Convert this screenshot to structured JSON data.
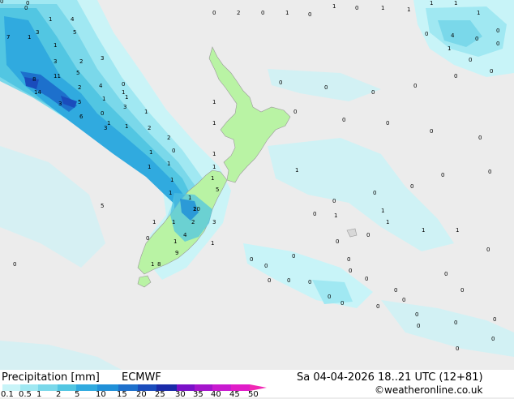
{
  "header": {
    "product": "Precipitation [mm]",
    "model": "ECMWF",
    "valid_time": "Sa 04-04-2026 18..21 UTC (12+81)",
    "credit": "©weatheronline.co.uk"
  },
  "legend": {
    "ticks": [
      "0.1",
      "0.5",
      "1",
      "2",
      "5",
      "10",
      "15",
      "20",
      "25",
      "30",
      "35",
      "40",
      "45",
      "50"
    ],
    "colors": [
      "#c8f4f8",
      "#a0e8f2",
      "#7ad8ea",
      "#52c6e2",
      "#30aadf",
      "#2090d8",
      "#1d70cc",
      "#1a4cbc",
      "#1a2aa8",
      "#7a10c8",
      "#a414cc",
      "#c81ad0",
      "#e01cc8",
      "#f028b4"
    ]
  },
  "map": {
    "land_color": "#b9f3a4",
    "sea_color": "#ececec",
    "values": [
      "0",
      "1",
      "4",
      "3",
      "5",
      "1",
      "7",
      "1",
      "3",
      "2",
      "3",
      "11",
      "5",
      "8",
      "2",
      "14",
      "3",
      "4",
      "6",
      "0",
      "1",
      "5",
      "1",
      "3",
      "1",
      "0",
      "1",
      "2",
      "1",
      "2",
      "0",
      "1",
      "1",
      "1",
      "1",
      "1",
      "1",
      "2",
      "3",
      "2",
      "1",
      "1",
      "4",
      "0",
      "9",
      "1",
      "1",
      "8",
      "1",
      "0",
      "5",
      "5",
      "1",
      "1",
      "1",
      "1",
      "1",
      "10",
      "1",
      "3",
      "0",
      "0",
      "2",
      "0",
      "1",
      "0",
      "1",
      "0",
      "1",
      "1",
      "1",
      "1",
      "1",
      "4",
      "0",
      "0",
      "0",
      "1",
      "0",
      "0",
      "0",
      "0",
      "0",
      "0",
      "0",
      "0",
      "0",
      "0",
      "0",
      "0",
      "0",
      "0",
      "0",
      "0",
      "0",
      "0",
      "0",
      "1",
      "1",
      "1",
      "1",
      "1",
      "1",
      "0",
      "0",
      "0",
      "0",
      "0",
      "0",
      "0",
      "0",
      "0",
      "0",
      "0",
      "0",
      "0",
      "0",
      "0",
      "0",
      "0",
      "0",
      "0",
      "0",
      "0",
      "0",
      "0",
      "0",
      "0",
      "0"
    ]
  }
}
